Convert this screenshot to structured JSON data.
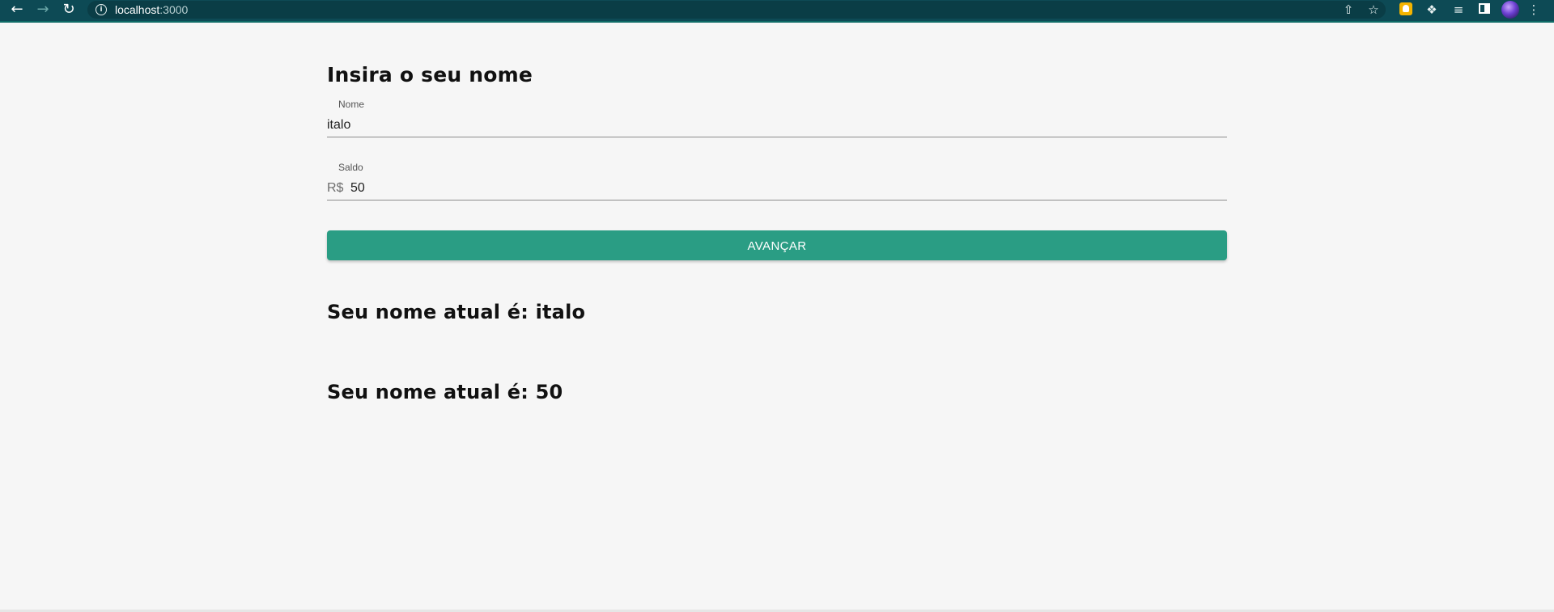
{
  "browser": {
    "url_host": "localhost",
    "url_port": ":3000",
    "back_icon": "←",
    "forward_icon": "→",
    "reload_icon": "↻",
    "info_icon": "i",
    "share_icon": "⇧",
    "star_icon": "☆",
    "puzzle_icon": "❖",
    "media_icon": "≡",
    "menu_icon": "⋮"
  },
  "form": {
    "title": "Insira o seu nome",
    "name_field": {
      "label": "Nome",
      "value": "italo"
    },
    "balance_field": {
      "label": "Saldo",
      "prefix": "R$",
      "value": "50"
    },
    "submit_label": "AVANÇAR"
  },
  "results": {
    "name_line": "Seu nome atual é: italo",
    "balance_line": "Seu nome atual é: 50"
  },
  "colors": {
    "toolbar": "#0d4a55",
    "button": "#2a9d84",
    "background": "#f6f6f6"
  }
}
